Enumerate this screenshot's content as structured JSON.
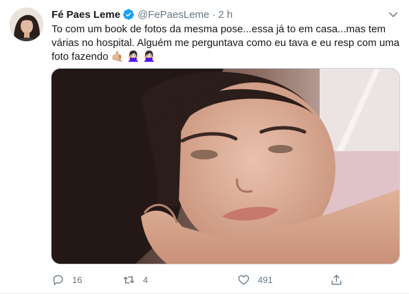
{
  "tweet": {
    "author_name": "Fé Paes Leme",
    "handle": "@FePaesLeme",
    "separator": "·",
    "time": "2 h",
    "text_line1": "To com um book de fotos da mesma pose...essa já to em casa...mas tem",
    "text_line2": "várias no hospital. Alguém me perguntava como eu tava e eu resp com uma",
    "text_line3": "foto fazendo",
    "emojis": [
      "🤙🏼",
      "🙅🏻‍♀️",
      "🙅🏻‍♀️"
    ],
    "reply_count": "16",
    "retweet_count": "4",
    "like_count": "491"
  },
  "icons": {
    "verified": "verified-badge-icon",
    "caret": "chevron-down-icon",
    "reply": "reply-icon",
    "retweet": "retweet-icon",
    "like": "heart-icon",
    "share": "share-icon"
  },
  "colors": {
    "verified": "#1da1f2",
    "secondary_text": "#657786",
    "primary_text": "#14171a"
  }
}
